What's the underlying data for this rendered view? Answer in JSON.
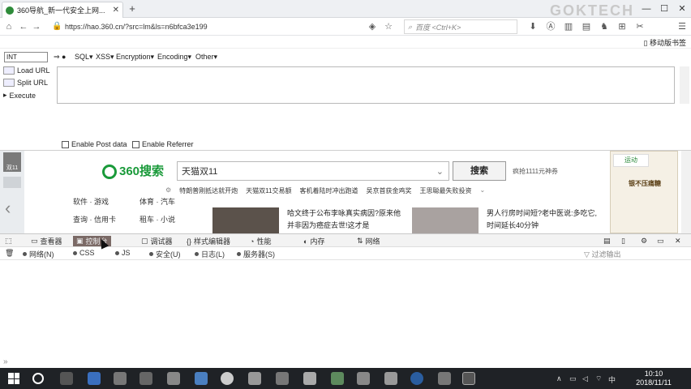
{
  "browser": {
    "tab_title": "360导航_新一代安全上网...",
    "url": "https://hao.360.cn/?src=lm&ls=n6bfca3e199",
    "search_placeholder": "百度 <Ctrl+K>",
    "watermark": "GOKTECH",
    "mobile_bookmarks": "移动版书签"
  },
  "hackbar": {
    "select_value": "INT",
    "menus": [
      "SQL▾",
      "XSS▾",
      "Encryption▾",
      "Encoding▾",
      "Other▾"
    ],
    "actions": [
      "Load URL",
      "Split URL",
      "Execute"
    ],
    "enable_post": "Enable Post data",
    "enable_referrer": "Enable Referrer"
  },
  "page": {
    "left_badge": "双11",
    "logo_text": "360搜索",
    "search_value": "天猫双11",
    "search_button": "搜索",
    "promo_text": "疯抢1111元神券",
    "hot_items": [
      "特朗普刚抵达就开炮",
      "天猫双11交易额",
      "客机着陆时冲出跑道",
      "吴京首获金鸡奖",
      "王思聪最失败投资"
    ],
    "categories": [
      "软件 · 游戏",
      "体育 · 汽车",
      "查询 · 信用卡",
      "租车 · 小说"
    ],
    "news_left": "哈文终于公布李咏真实病因?原来他并非因为癌症去世!这才是",
    "news_right": "男人行房时间短?老中医说:多吃它,时间延长40分钟",
    "weather": "运动",
    "ad_title": "银不压痛糖"
  },
  "devtools": {
    "tabs": [
      "查看器",
      "控制台",
      "调试器",
      "样式编辑器",
      "性能",
      "内存",
      "网络"
    ],
    "active_tab": "控制台",
    "filters": [
      "网络(N)",
      "CSS",
      "JS",
      "安全(U)",
      "日志(L)",
      "服务器(S)"
    ],
    "filter_output": "过滤输出",
    "prompt": "»"
  },
  "taskbar": {
    "time": "10:10",
    "date": "2018/11/11",
    "ime": "中"
  },
  "colors": {
    "accent_green": "#1a9a3a",
    "devtools_active": "#7b6a66",
    "taskbar": "#1f2226"
  }
}
